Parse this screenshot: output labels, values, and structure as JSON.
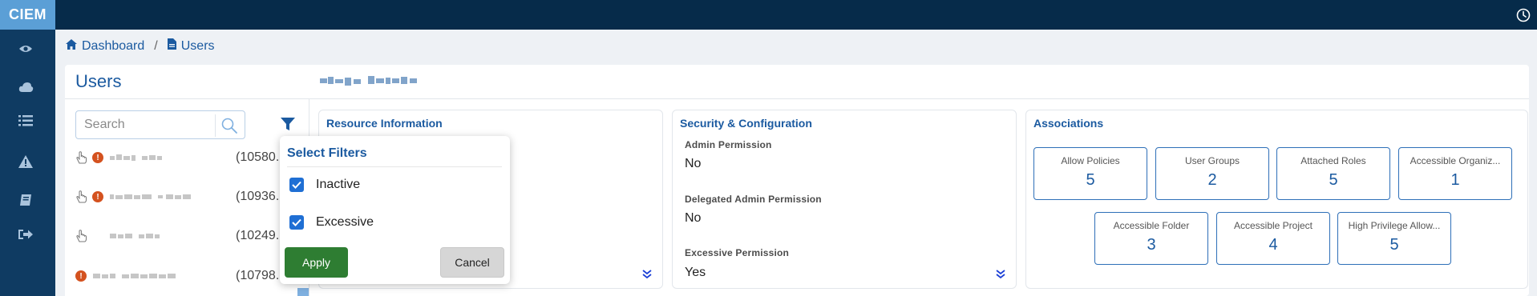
{
  "app": {
    "logo_text": "CIEM"
  },
  "sidebar": {
    "items": [
      {
        "icon": "eye-icon"
      },
      {
        "icon": "cloud-icon"
      },
      {
        "icon": "list-icon"
      },
      {
        "icon": "warning-icon"
      },
      {
        "icon": "book-icon"
      },
      {
        "icon": "sign-out-icon"
      }
    ]
  },
  "breadcrumb": {
    "home": "Dashboard",
    "separator": "/",
    "current": "Users"
  },
  "page": {
    "title": "Users"
  },
  "search": {
    "placeholder": "Search",
    "value": ""
  },
  "users": [
    {
      "id": "(10580.",
      "alert": "!"
    },
    {
      "id": "(10936.",
      "alert": "!"
    },
    {
      "id": "(10249."
    },
    {
      "id": "(10798.",
      "alert": "!"
    }
  ],
  "resource_info": {
    "title": "Resource Information"
  },
  "security": {
    "title": "Security & Configuration",
    "fields": [
      {
        "label": "Admin Permission",
        "value": "No"
      },
      {
        "label": "Delegated Admin Permission",
        "value": "No"
      },
      {
        "label": "Excessive Permission",
        "value": "Yes"
      }
    ]
  },
  "associations": {
    "title": "Associations",
    "tiles": [
      {
        "label": "Allow Policies",
        "value": "5"
      },
      {
        "label": "User Groups",
        "value": "2"
      },
      {
        "label": "Attached Roles",
        "value": "5"
      },
      {
        "label": "Accessible Organiz...",
        "value": "1"
      },
      {
        "label": "Accessible Folder",
        "value": "3"
      },
      {
        "label": "Accessible Project",
        "value": "4"
      },
      {
        "label": "High Privilege Allow...",
        "value": "5"
      }
    ]
  },
  "filters_popup": {
    "title": "Select Filters",
    "options": [
      {
        "label": "Inactive",
        "checked": true
      },
      {
        "label": "Excessive",
        "checked": true
      }
    ],
    "apply_label": "Apply",
    "cancel_label": "Cancel"
  },
  "colors": {
    "topbar": "#062b4a",
    "sidebar": "#0f3b62",
    "logo_bg": "#5b9fd6",
    "accent": "#1b5aa0",
    "apply": "#2e7d32",
    "alert": "#d4521f"
  }
}
